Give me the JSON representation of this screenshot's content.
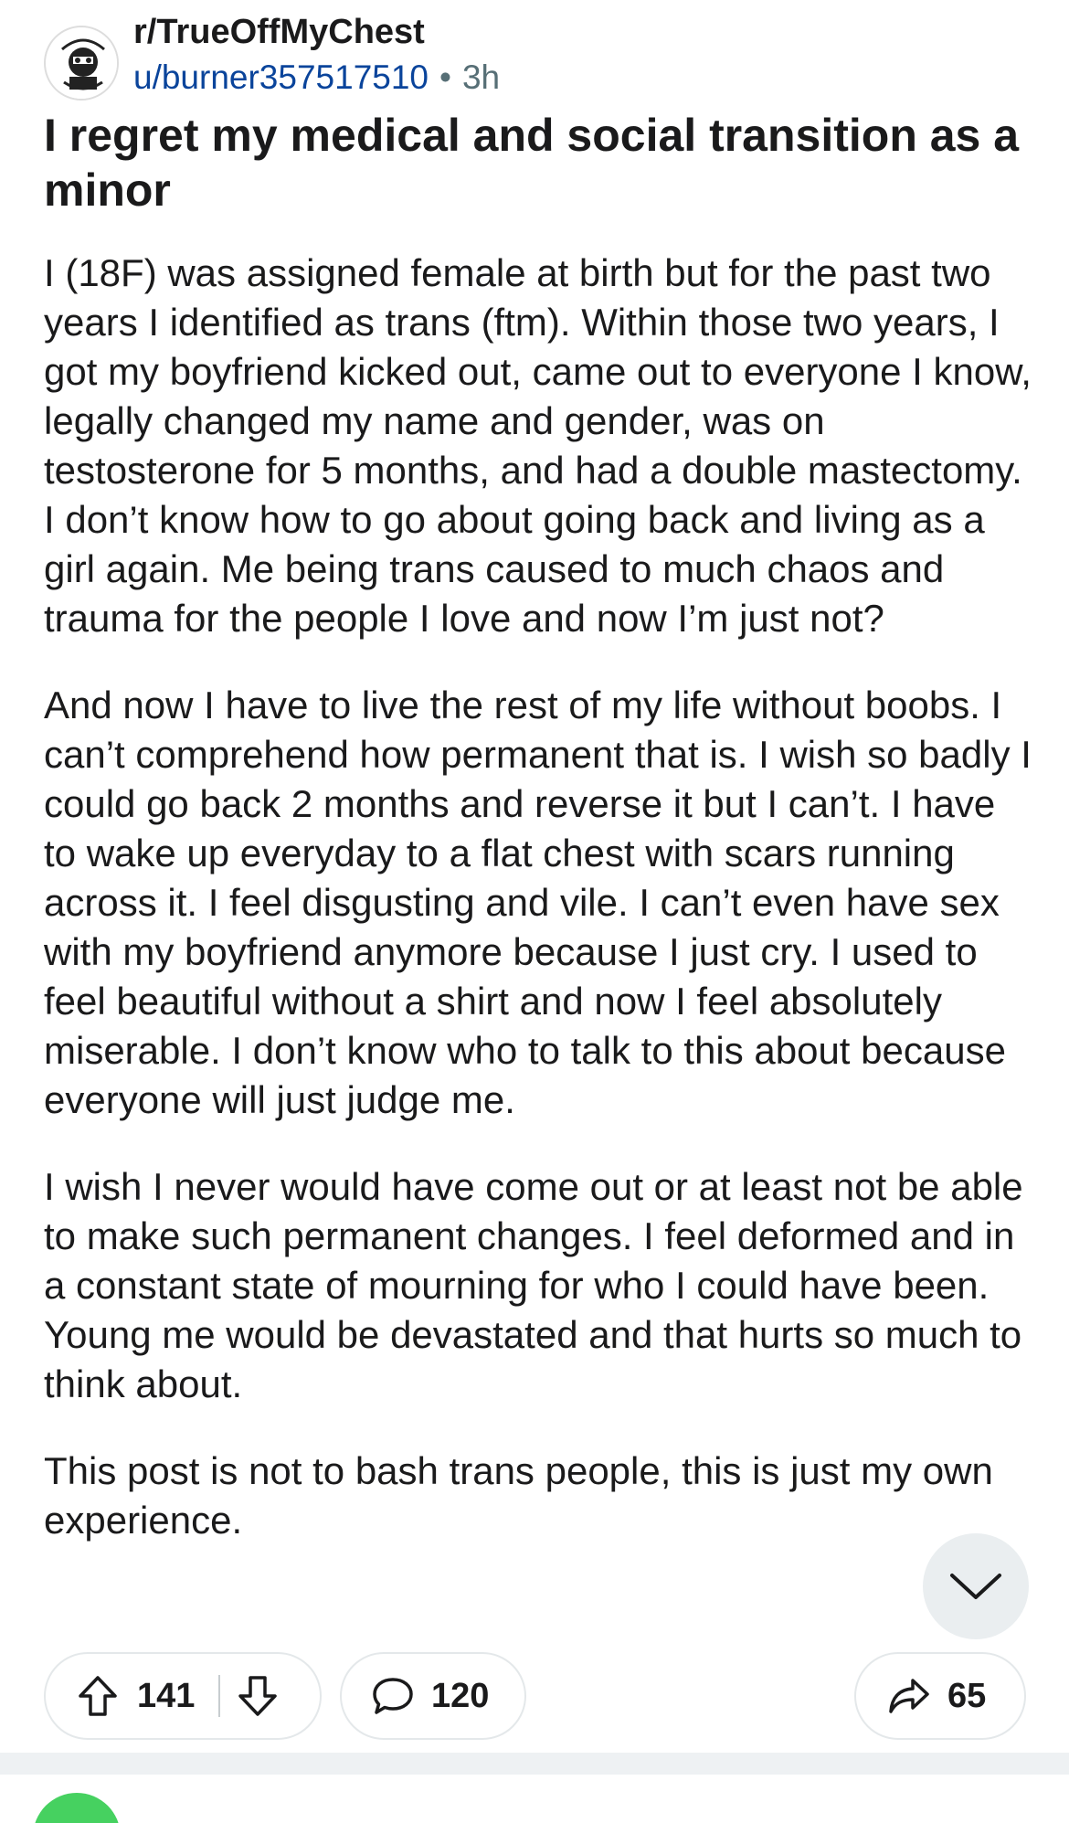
{
  "post": {
    "subreddit": "r/TrueOffMyChest",
    "author": "u/burner357517510",
    "separator": "•",
    "age": "3h",
    "title": "I regret my medical and social transition as a minor",
    "paragraphs": [
      "I (18F) was assigned female at birth but for the past two years I identified as trans (ftm). Within those two years, I got my boyfriend kicked out, came out to everyone I know, legally changed my name and gender, was on testosterone for 5 months, and had a double mastectomy. I don’t know how to go about going back and living as a girl again. Me being trans caused to much chaos and trauma for the people I love and now I’m just not?",
      "And now I have to live the rest of my life without boobs. I can’t comprehend how permanent that is. I wish so badly I could go back 2 months and reverse it but I can’t. I have to wake up everyday to a flat chest with scars running across it. I feel disgusting and vile. I can’t even have sex with my boyfriend anymore because I just cry. I used to feel beautiful without a shirt and now I feel absolutely miserable. I don’t know who to talk to this about because everyone will just judge me.",
      "I wish I never would have come out or at least not be able to make such permanent changes. I feel deformed and in a constant state of mourning for who I could have been. Young me would be devastated and that hurts so much to think about.",
      "This post is not to bash trans people, this is just my own experience."
    ]
  },
  "actions": {
    "upvotes": "141",
    "comments": "120",
    "shares": "65"
  },
  "icons": {
    "upvote": "upvote-icon",
    "downvote": "downvote-icon",
    "comment": "comment-icon",
    "share": "share-icon",
    "scroll": "chevron-down-icon"
  },
  "colors": {
    "author_link": "#0a449b",
    "meta_gray": "#576f76",
    "pill_border": "#e4e8ea",
    "scroll_button": "#eaeef0",
    "next_avatar": "#46d160"
  }
}
